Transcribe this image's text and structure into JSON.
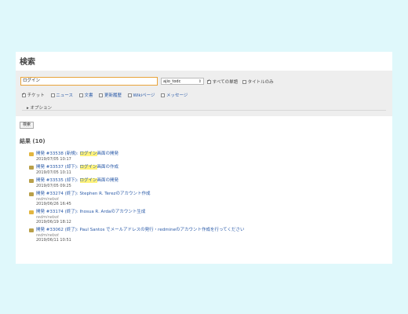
{
  "page": {
    "title": "検索"
  },
  "search": {
    "query": "ログイン",
    "scope": "ajio_todc",
    "all_words_label": "すべての単語",
    "titles_only_label": "タイトルのみ",
    "types": [
      {
        "label": "チケット",
        "checked": true
      },
      {
        "label": "ニュース",
        "checked": false
      },
      {
        "label": "文書",
        "checked": false
      },
      {
        "label": "更新履歴",
        "checked": false
      },
      {
        "label": "Wikiページ",
        "checked": false
      },
      {
        "label": "メッセージ",
        "checked": false
      }
    ],
    "options_label": "▸ オプション",
    "submit_label": "検索"
  },
  "results": {
    "heading": "結果 (10)",
    "items": [
      {
        "pre": "開発 #33538 (新規): ",
        "hl": "ログイン",
        "post": "画面の開発",
        "author": "",
        "date": "2019/07/05 10:17",
        "icon": "bug"
      },
      {
        "pre": "開発 #33537 (却下): ",
        "hl": "ログイン",
        "post": "画面の作成",
        "author": "",
        "date": "2019/07/05 10:11",
        "icon": "task"
      },
      {
        "pre": "開発 #33535 (却下): ",
        "hl": "ログイン",
        "post": "画面の開発",
        "author": "",
        "date": "2019/07/05 09:25",
        "icon": "task"
      },
      {
        "pre": "開発 #33274 (終了): Stephen R. Terezのアカウント作成",
        "hl": "",
        "post": "",
        "author": "redminebot",
        "date": "2019/06/26 16:45",
        "icon": "task"
      },
      {
        "pre": "開発 #33174 (終了): Ihosua R. Ardaのアカウント生成",
        "hl": "",
        "post": "",
        "author": "redminebot",
        "date": "2019/06/19 18:12",
        "icon": "bug"
      },
      {
        "pre": "開発 #33062 (終了): Paul Santos でメールアドレスの発行・redmineのアカウント作成を行ってください",
        "hl": "",
        "post": "",
        "author": "redminebot",
        "date": "2019/06/11 10:51",
        "icon": "task"
      }
    ]
  }
}
